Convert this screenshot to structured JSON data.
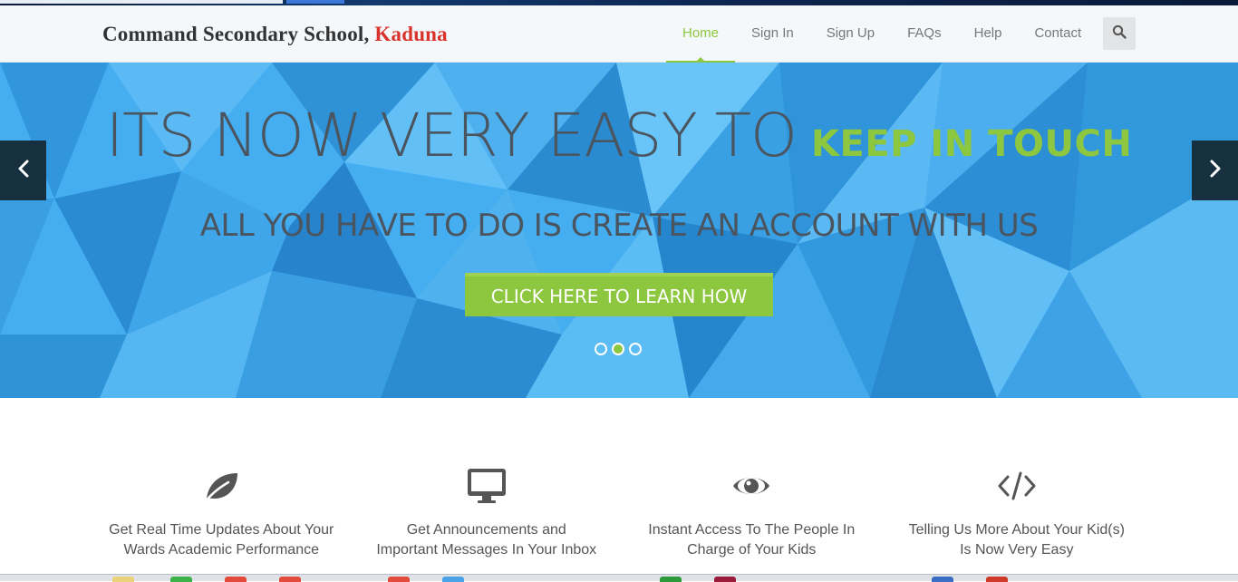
{
  "brand": {
    "name": "Command Secondary School,",
    "city": "Kaduna"
  },
  "nav": [
    {
      "label": "Home",
      "active": true
    },
    {
      "label": "Sign In",
      "active": false
    },
    {
      "label": "Sign Up",
      "active": false
    },
    {
      "label": "FAQs",
      "active": false
    },
    {
      "label": "Help",
      "active": false
    },
    {
      "label": "Contact",
      "active": false
    }
  ],
  "search": {
    "icon": "search-icon"
  },
  "hero": {
    "headline": "ITS NOW VERY EASY TO",
    "headline_accent": "KEEP IN TOUCH",
    "subheadline": "ALL YOU HAVE TO DO IS CREATE AN ACCOUNT WITH US",
    "cta_label": "CLICK HERE TO LEARN HOW",
    "slides_total": 3,
    "active_slide": 2
  },
  "features": [
    {
      "icon": "leaf-icon",
      "line1": "Get Real Time Updates About Your",
      "line2": "Wards Academic Performance"
    },
    {
      "icon": "monitor-icon",
      "line1": "Get Announcements and",
      "line2": "Important Messages In Your Inbox"
    },
    {
      "icon": "eye-icon",
      "line1": "Instant Access To The People In",
      "line2": "Charge of Your Kids"
    },
    {
      "icon": "code-icon",
      "line1": "Telling Us More About Your Kid(s)",
      "line2": "Is Now Very Easy"
    }
  ],
  "colors": {
    "accent": "#8dc63f",
    "brand_red": "#d9332b",
    "hero_blue": "#3ea6ea",
    "text": "#555555"
  }
}
